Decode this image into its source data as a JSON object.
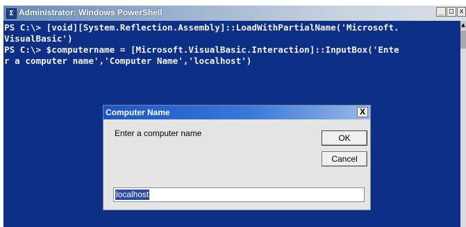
{
  "window": {
    "title": "Administrator: Windows PowerShell",
    "min_glyph": "_",
    "max_glyph": "□",
    "close_glyph": "x",
    "icon_name": "powershell-icon",
    "icon_glyph": "Σ"
  },
  "console": {
    "lines": [
      "PS C:\\> [void][System.Reflection.Assembly]::LoadWithPartialName('Microsoft.",
      "VisualBasic')",
      "PS C:\\> $computername = [Microsoft.VisualBasic.Interaction]::InputBox('Ente",
      "r a computer name','Computer Name','localhost')"
    ],
    "background": "#0d2f85",
    "scroll_up_glyph": "▲"
  },
  "dialog": {
    "title": "Computer Name",
    "close_glyph": "X",
    "prompt": "Enter a computer name",
    "ok_label": "OK",
    "cancel_label": "Cancel",
    "input_value": "localhost"
  }
}
